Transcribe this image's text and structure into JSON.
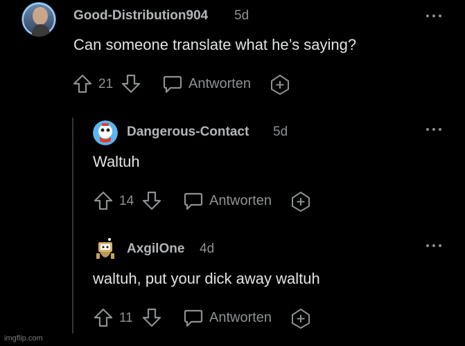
{
  "comments": [
    {
      "username": "Good-Distribution904",
      "time": "5d",
      "text": "Can someone translate what he’s saying?",
      "votes": "21",
      "reply_label": "Antworten",
      "avatar_icon": "user-avatar-icon"
    },
    {
      "username": "Dangerous-Contact",
      "time": "5d",
      "text": "Waltuh",
      "votes": "14",
      "reply_label": "Antworten",
      "avatar_icon": "user-avatar-icon"
    },
    {
      "username": "AxgilOne",
      "time": "4d",
      "text": "waltuh, put your dick away waltuh",
      "votes": "11",
      "reply_label": "Antworten",
      "avatar_icon": "user-avatar-icon"
    }
  ],
  "watermark": "imgflip.com",
  "colors": {
    "background": "#000000",
    "username": "#b3b6b8",
    "meta": "#8e9193",
    "text": "#e1e3e5",
    "thread_line": "#343536"
  }
}
